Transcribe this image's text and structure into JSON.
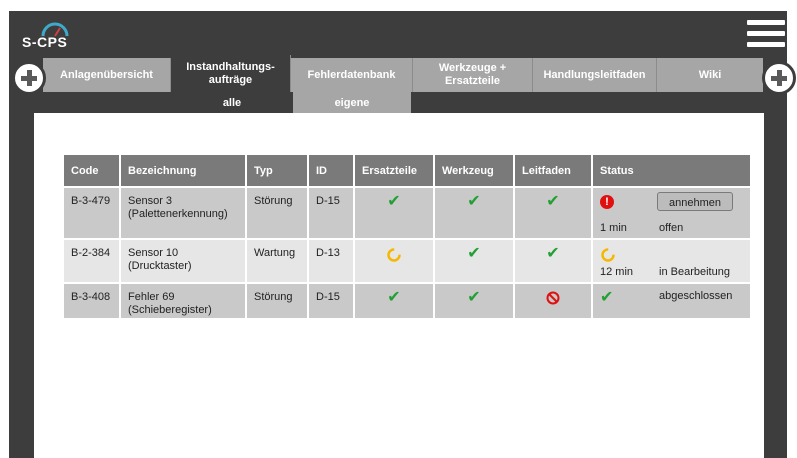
{
  "app": {
    "logo_text": "S-CPS"
  },
  "nav": {
    "tabs": [
      {
        "label": "Anlagenübersicht"
      },
      {
        "label": "Instandhaltungs-\naufträge"
      },
      {
        "label": "Fehlerdatenbank"
      },
      {
        "label": "Werkzeuge +\nErsatzteile"
      },
      {
        "label": "Handlungsleitfaden"
      },
      {
        "label": "Wiki"
      }
    ],
    "active_tab": "Instandhaltungs-\naufträge",
    "sub_tabs": [
      {
        "label": "alle"
      },
      {
        "label": "eigene"
      }
    ],
    "active_sub_tab": "alle"
  },
  "table": {
    "columns": [
      "Code",
      "Bezeichnung",
      "Typ",
      "ID",
      "Ersatzteile",
      "Werkzeug",
      "Leitfaden",
      "Status"
    ],
    "rows": [
      {
        "code": "B-3-479",
        "name_line1": "Sensor 3",
        "name_line2": "(Palettenerkennung)",
        "typ": "Störung",
        "id": "D-15",
        "ersatzteile": "check",
        "werkzeug": "check",
        "leitfaden": "check",
        "status_icon": "error-icon",
        "status_time": "1 min",
        "status_text": "offen",
        "action": "annehmen"
      },
      {
        "code": "B-2-384",
        "name_line1": "Sensor 10",
        "name_line2": "(Drucktaster)",
        "typ": "Wartung",
        "id": "D-13",
        "ersatzteile": "in-progress",
        "werkzeug": "check",
        "leitfaden": "check",
        "status_icon": "in-progress-icon",
        "status_time": "12 min",
        "status_text": "in Bearbeitung"
      },
      {
        "code": "B-3-408",
        "name_line1": "Fehler 69",
        "name_line2": "(Schieberegister)",
        "typ": "Störung",
        "id": "D-15",
        "ersatzteile": "check",
        "werkzeug": "check",
        "leitfaden": "forbidden",
        "status_icon": "check-icon",
        "status_time": "",
        "status_text": "abgeschlossen"
      }
    ]
  },
  "colors": {
    "accent_check": "#22a033",
    "warn": "#e01010",
    "progress": "#f5b800",
    "forbidden": "#e01010",
    "frame": "#3d3d3d",
    "tab": "#a6a6a6"
  }
}
